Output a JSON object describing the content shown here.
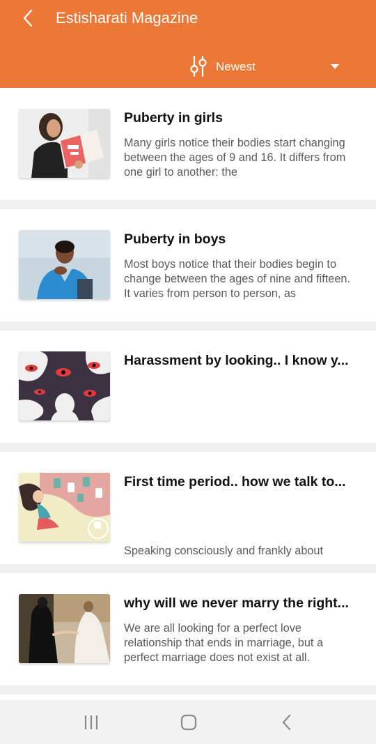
{
  "header": {
    "title": "Estisharati Magazine",
    "back_icon": "chevron-left-icon",
    "background_color": "#ec7838"
  },
  "sort": {
    "icon": "sliders-icon",
    "label": "Newest",
    "dropdown_icon": "caret-down-icon"
  },
  "articles": [
    {
      "title": "Puberty in girls",
      "excerpt": "Many girls notice their bodies start changing between the ages of 9 and 16. It differs from one girl to another: the",
      "image": "girl-reading-magazine"
    },
    {
      "title": "Puberty in boys",
      "excerpt": "Most boys notice that their bodies begin to change between the ages of nine and fifteen. It varies from person to person, as",
      "image": "smiling-young-man"
    },
    {
      "title": "Harassment by looking.. I know y...",
      "excerpt": "",
      "image": "eyes-illustration"
    },
    {
      "title": "First time period.. how we talk to...",
      "excerpt": "Speaking consciously and frankly about",
      "image": "girl-illustration"
    },
    {
      "title": "why will we never marry the right...",
      "excerpt": "We are all looking for a perfect love relationship that ends in marriage, but a perfect marriage does not exist at all.",
      "image": "wedding-couple"
    }
  ],
  "navbar": {
    "recents_icon": "recents-icon",
    "home_icon": "home-icon",
    "back_icon": "back-icon"
  }
}
